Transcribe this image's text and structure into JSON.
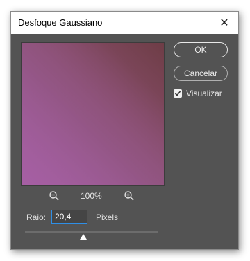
{
  "dialog": {
    "title": "Desfoque Gaussiano",
    "close_icon": "close-icon"
  },
  "buttons": {
    "ok": "OK",
    "cancel": "Cancelar"
  },
  "preview_toggle": {
    "label": "Visualizar",
    "checked": true
  },
  "zoom": {
    "level": "100%",
    "zoom_out_icon": "zoom-out-icon",
    "zoom_in_icon": "zoom-in-icon"
  },
  "radius": {
    "label": "Raio:",
    "value": "20,4",
    "unit": "Pixels",
    "slider_fraction": 0.44
  },
  "colors": {
    "dialog_bg": "#535353",
    "accent": "#2f8fe6",
    "preview_light": "#a2639c",
    "preview_dark": "#6e3d46"
  }
}
